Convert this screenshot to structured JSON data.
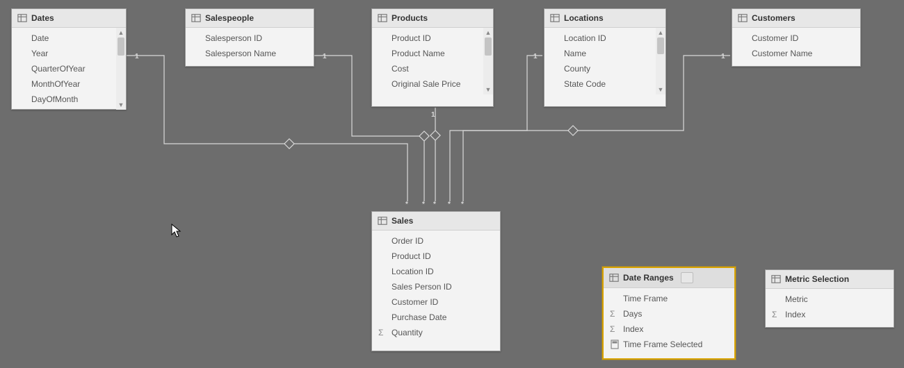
{
  "tables": {
    "dates": {
      "title": "Dates",
      "fields": [
        "Date",
        "Year",
        "QuarterOfYear",
        "MonthOfYear",
        "DayOfMonth"
      ]
    },
    "salespeople": {
      "title": "Salespeople",
      "fields": [
        "Salesperson ID",
        "Salesperson Name"
      ]
    },
    "products": {
      "title": "Products",
      "fields": [
        "Product ID",
        "Product Name",
        "Cost",
        "Original Sale Price"
      ]
    },
    "locations": {
      "title": "Locations",
      "fields": [
        "Location ID",
        "Name",
        "County",
        "State Code"
      ]
    },
    "customers": {
      "title": "Customers",
      "fields": [
        "Customer ID",
        "Customer Name"
      ]
    },
    "sales": {
      "title": "Sales",
      "fields": [
        "Order ID",
        "Product ID",
        "Location ID",
        "Sales Person ID",
        "Customer ID",
        "Purchase Date",
        "Quantity"
      ],
      "sigma": [
        6
      ]
    },
    "dateranges": {
      "title": "Date Ranges",
      "fields": [
        "Time Frame",
        "Days",
        "Index",
        "Time Frame Selected"
      ],
      "sigma": [
        1,
        2
      ],
      "calc": [
        3
      ]
    },
    "metric": {
      "title": "Metric Selection",
      "fields": [
        "Metric",
        "Index"
      ],
      "sigma": [
        1
      ]
    }
  },
  "relationships": [
    {
      "from": "dates",
      "to": "sales",
      "from_card": "1",
      "to_card": "*"
    },
    {
      "from": "salespeople",
      "to": "sales",
      "from_card": "1",
      "to_card": "*"
    },
    {
      "from": "products",
      "to": "sales",
      "from_card": "1",
      "to_card": "*"
    },
    {
      "from": "locations",
      "to": "sales",
      "from_card": "1",
      "to_card": "*"
    },
    {
      "from": "customers",
      "to": "sales",
      "from_card": "1",
      "to_card": "*"
    }
  ]
}
